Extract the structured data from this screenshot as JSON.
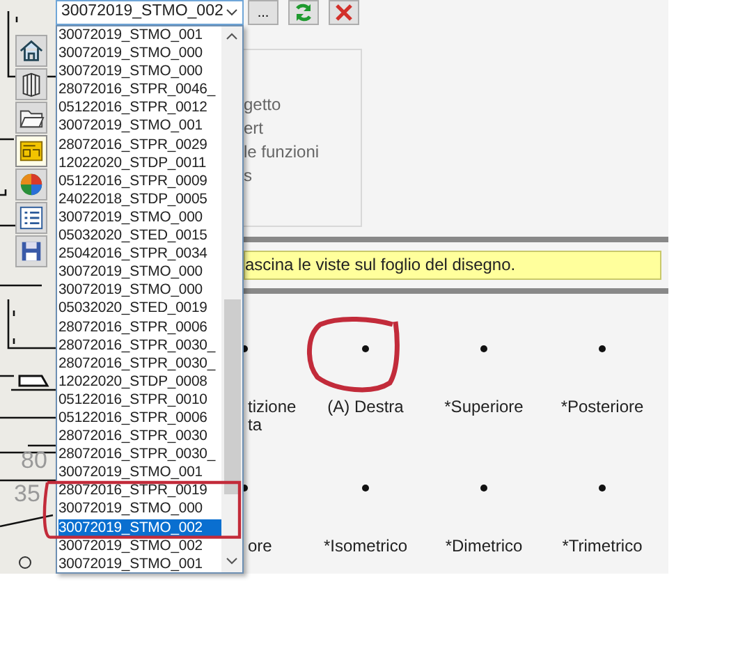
{
  "combo": {
    "value": "30072019_STMO_002"
  },
  "toolbar": [
    {
      "kind": "more",
      "label": "..."
    },
    {
      "kind": "refresh"
    },
    {
      "kind": "close"
    }
  ],
  "sidebar_icons": [
    {
      "kind": "home",
      "selected": false
    },
    {
      "kind": "book",
      "selected": false
    },
    {
      "kind": "folder",
      "selected": false
    },
    {
      "kind": "layout",
      "selected": true
    },
    {
      "kind": "color",
      "selected": false
    },
    {
      "kind": "list",
      "selected": false
    },
    {
      "kind": "save",
      "selected": false
    }
  ],
  "list": {
    "items": [
      {
        "label": "30072019_STMO_001",
        "selected": false
      },
      {
        "label": "30072019_STMO_000",
        "selected": false
      },
      {
        "label": "30072019_STMO_000",
        "selected": false
      },
      {
        "label": "28072016_STPR_0046_",
        "selected": false
      },
      {
        "label": "05122016_STPR_0012",
        "selected": false
      },
      {
        "label": "30072019_STMO_001",
        "selected": false
      },
      {
        "label": "28072016_STPR_0029",
        "selected": false
      },
      {
        "label": "12022020_STDP_0011",
        "selected": false
      },
      {
        "label": "05122016_STPR_0009",
        "selected": false
      },
      {
        "label": "24022018_STDP_0005",
        "selected": false
      },
      {
        "label": "30072019_STMO_000",
        "selected": false
      },
      {
        "label": "05032020_STED_0015",
        "selected": false
      },
      {
        "label": "25042016_STPR_0034",
        "selected": false
      },
      {
        "label": "30072019_STMO_000",
        "selected": false
      },
      {
        "label": "30072019_STMO_000",
        "selected": false
      },
      {
        "label": "05032020_STED_0019",
        "selected": false
      },
      {
        "label": "28072016_STPR_0006",
        "selected": false
      },
      {
        "label": "28072016_STPR_0030_",
        "selected": false
      },
      {
        "label": "28072016_STPR_0030_",
        "selected": false
      },
      {
        "label": "12022020_STDP_0008",
        "selected": false
      },
      {
        "label": "05122016_STPR_0010",
        "selected": false
      },
      {
        "label": "05122016_STPR_0006",
        "selected": false
      },
      {
        "label": "28072016_STPR_0030",
        "selected": false
      },
      {
        "label": "28072016_STPR_0030_",
        "selected": false
      },
      {
        "label": "30072019_STMO_001",
        "selected": false
      },
      {
        "label": "28072016_STPR_0019",
        "selected": false
      },
      {
        "label": "30072019_STMO_000",
        "selected": false
      },
      {
        "label": "30072019_STMO_002",
        "selected": true
      },
      {
        "label": "30072019_STMO_002",
        "selected": false
      },
      {
        "label": "30072019_STMO_001",
        "selected": false
      }
    ]
  },
  "panel_options": [
    "getto",
    "ert",
    "le funzioni",
    "s"
  ],
  "hint": "ascina le viste sul foglio del disegno.",
  "views": [
    {
      "lines": [
        "tizione",
        "ta"
      ]
    },
    {
      "lines": [
        "(A) Destra"
      ]
    },
    {
      "lines": [
        "*Superiore"
      ]
    },
    {
      "lines": [
        "*Posteriore"
      ]
    },
    {
      "lines": [
        "ore"
      ]
    },
    {
      "lines": [
        "*Isometrico"
      ]
    },
    {
      "lines": [
        "*Dimetrico"
      ]
    },
    {
      "lines": [
        "*Trimetrico"
      ]
    }
  ],
  "drawing_labels": [
    "80",
    "35"
  ],
  "annotations": [
    {
      "kind": "circle"
    },
    {
      "kind": "rect"
    }
  ]
}
